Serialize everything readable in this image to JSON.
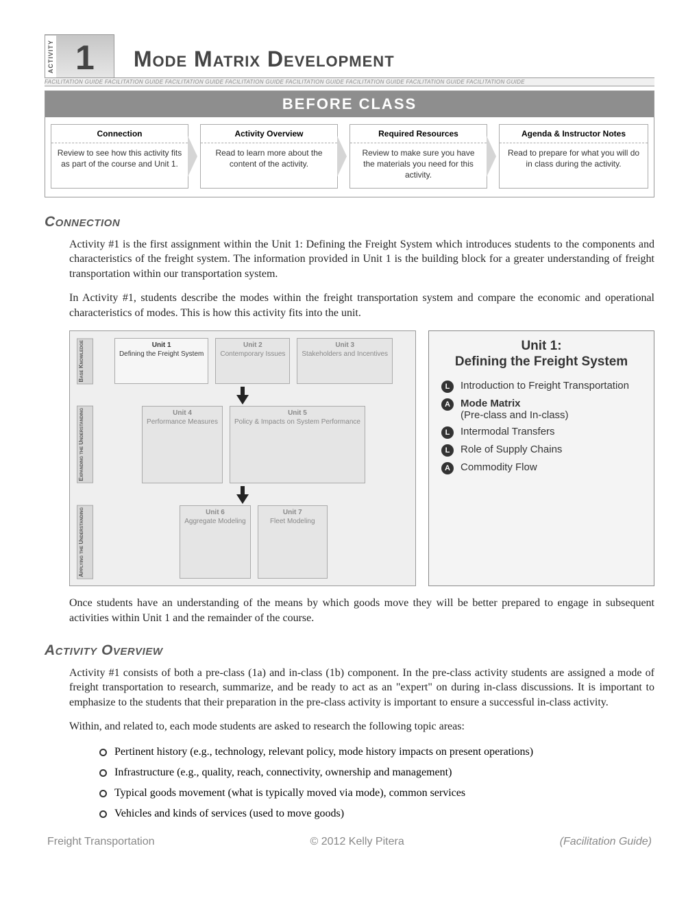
{
  "header": {
    "activity_label": "ACTIVITY",
    "activity_number": "1",
    "title": "Mode Matrix Development",
    "strip": "FACILITATION GUIDE    FACILITATION GUIDE    FACILITATION GUIDE    FACILITATION GUIDE    FACILITATION GUIDE    FACILITATION GUIDE    FACILITATION GUIDE    FACILITATION GUIDE"
  },
  "before": {
    "title": "BEFORE CLASS",
    "cards": [
      {
        "title": "Connection",
        "body": "Review to see how this activity fits as part of the course and Unit 1."
      },
      {
        "title": "Activity Overview",
        "body": "Read to learn more about the content of the activity."
      },
      {
        "title": "Required Resources",
        "body": "Review to make sure you have the materials you need for this activity."
      },
      {
        "title": "Agenda & Instructor Notes",
        "body": "Read to prepare for what you will do in class during the activity."
      }
    ]
  },
  "connection": {
    "heading": "Connection",
    "p1": "Activity #1 is the first assignment within the Unit 1: Defining the Freight System which introduces students to the components and characteristics of the freight system. The information provided in Unit 1 is the building block for a greater understanding of freight transportation within our transportation system.",
    "p2": "In Activity #1, students describe the modes within the freight transportation system and compare the economic and operational characteristics of modes. This is how this activity fits into the unit.",
    "p3": "Once students have an understanding of the means by which goods move they will be better prepared to engage in subsequent activities within Unit 1 and the remainder of the course."
  },
  "diagram": {
    "rows": [
      {
        "label": "Base Knowledge",
        "cells": [
          {
            "h": "Unit 1",
            "t": "Defining the Freight System",
            "active": true
          },
          {
            "h": "Unit 2",
            "t": "Contemporary Issues",
            "active": false
          },
          {
            "h": "Unit 3",
            "t": "Stakeholders and Incentives",
            "active": false
          }
        ]
      },
      {
        "label": "Expanding the Understanding",
        "cells": [
          {
            "h": "Unit 4",
            "t": "Performance Measures",
            "active": false
          },
          {
            "h": "Unit 5",
            "t": "Policy & Impacts on System Performance",
            "active": false
          }
        ]
      },
      {
        "label": "Applying the Understanding",
        "cells": [
          {
            "h": "Unit 6",
            "t": "Aggregate Modeling",
            "active": false
          },
          {
            "h": "Unit 7",
            "t": "Fleet Modeling",
            "active": false
          }
        ]
      }
    ]
  },
  "unitbox": {
    "title": "Unit 1:\nDefining the Freight System",
    "items": [
      {
        "badge": "L",
        "text": "Introduction to Freight Transportation",
        "bold": false
      },
      {
        "badge": "A",
        "text": "Mode Matrix",
        "sub": "(Pre-class and In-class)",
        "bold": true
      },
      {
        "badge": "L",
        "text": "Intermodal Transfers",
        "bold": false
      },
      {
        "badge": "L",
        "text": "Role of Supply Chains",
        "bold": false
      },
      {
        "badge": "A",
        "text": "Commodity Flow",
        "bold": false
      }
    ]
  },
  "overview": {
    "heading": "Activity Overview",
    "p1": "Activity #1 consists of both a pre-class (1a) and in-class (1b) component. In the pre-class activity students are assigned a mode of freight transportation to research, summarize, and be ready to act as an \"expert\" on during in-class discussions. It is important to emphasize to the students that their preparation in the pre-class activity is important to ensure a successful in-class activity.",
    "p2": "Within, and related to, each mode students are asked to research the following topic areas:",
    "topics": [
      "Pertinent history (e.g., technology, relevant policy, mode history impacts on present operations)",
      "Infrastructure (e.g., quality, reach, connectivity, ownership and management)",
      "Typical goods movement (what is typically moved via mode), common services",
      "Vehicles and kinds of services (used to move goods)"
    ]
  },
  "footer": {
    "left": "Freight Transportation",
    "center": "© 2012 Kelly Pitera",
    "right": "(Facilitation Guide)"
  }
}
